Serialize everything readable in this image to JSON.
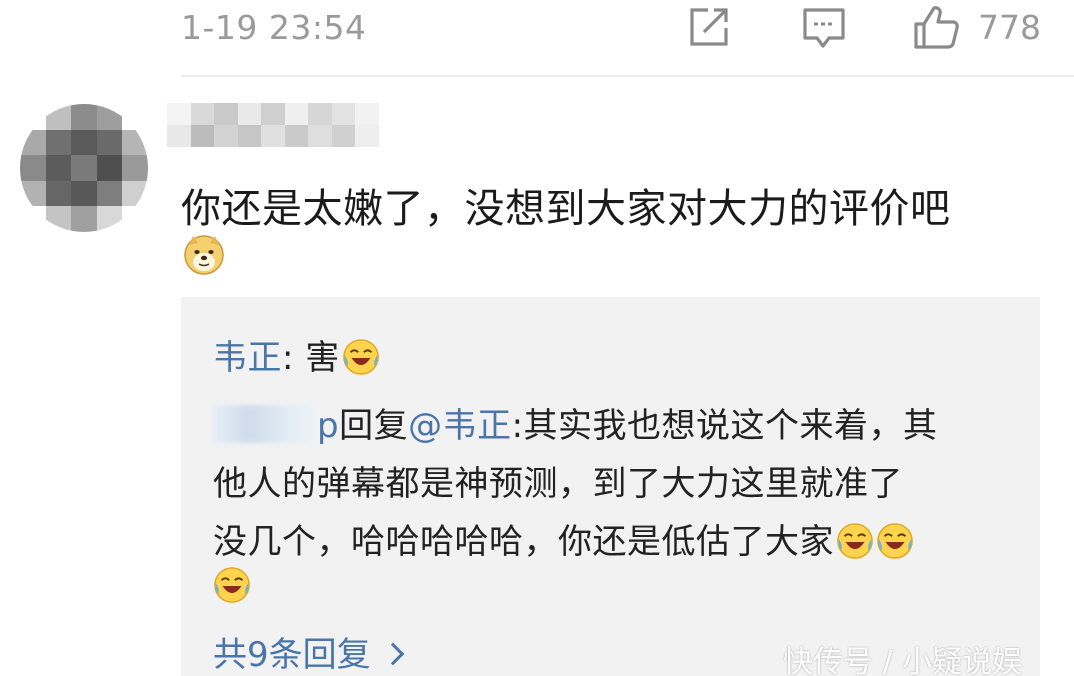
{
  "header": {
    "timestamp": "1-19 23:54",
    "like_count": "778",
    "icons": [
      "share-icon",
      "comment-icon",
      "like-icon"
    ]
  },
  "comment": {
    "text": "你还是太嫩了，没想到大家对大力的评价吧",
    "emoji": "doge-emoji"
  },
  "replies": {
    "first": {
      "author": "韦正",
      "separator": ":",
      "text": " 害",
      "emoji": "laugh-cry-emoji"
    },
    "second": {
      "author_suffix": "p",
      "reply_word": "回复",
      "mention": "@韦正",
      "line1": ":其实我也想说这个来着，其",
      "line2": "他人的弹幕都是神预测，到了大力这里就准了",
      "line3": "没几个，哈哈哈哈哈，你还是低估了大家"
    },
    "more_label": "共9条回复"
  },
  "watermark": "快传号 / 小疑说娱",
  "colors": {
    "link_blue": "#4a75a9",
    "muted_gray": "#9a9a9a",
    "reply_bg": "#f2f2f2"
  }
}
